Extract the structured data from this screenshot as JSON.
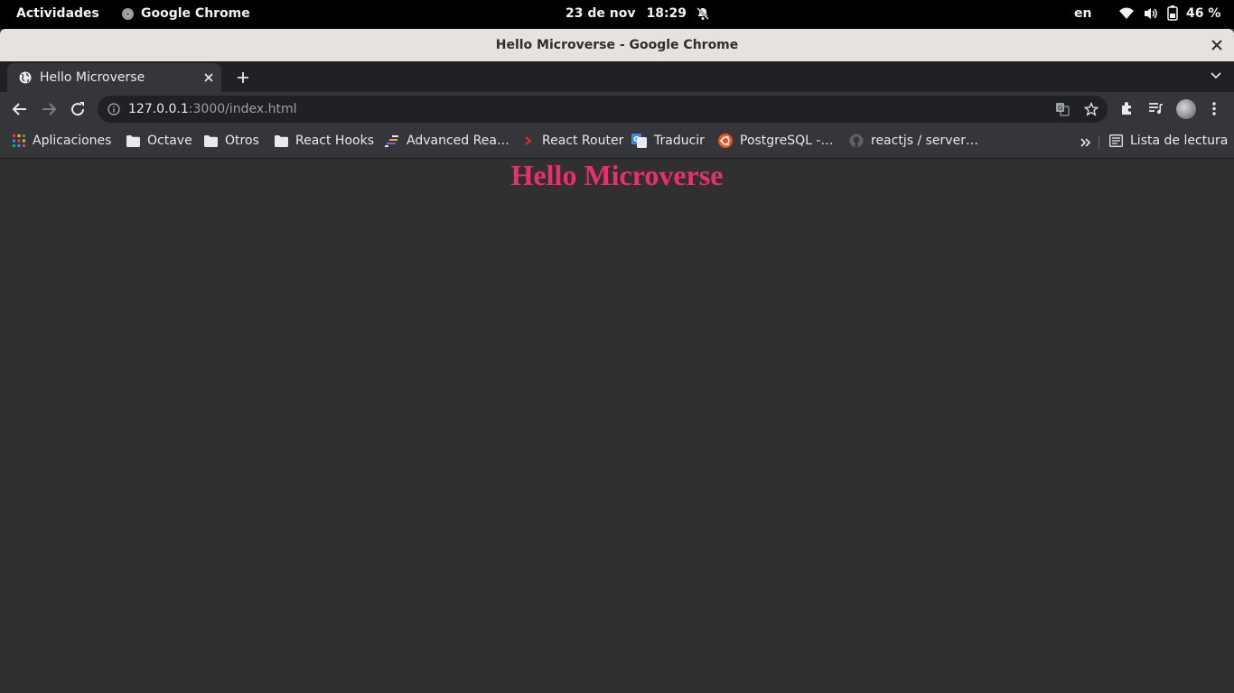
{
  "topbar": {
    "activities": "Actividades",
    "app_name": "Google Chrome",
    "date": "23 de nov",
    "time": "18:29",
    "lang": "en",
    "battery": "46 %"
  },
  "window": {
    "title": "Hello Microverse - Google Chrome"
  },
  "tabs": [
    {
      "label": "Hello Microverse",
      "active": true
    }
  ],
  "omnibox": {
    "host": "127.0.0.1",
    "path": ":3000/index.html"
  },
  "bookmarks": {
    "items": [
      {
        "label": "Aplicaciones",
        "icon": "apps-grid-icon"
      },
      {
        "label": "Octave",
        "icon": "folder-icon"
      },
      {
        "label": "Otros",
        "icon": "folder-icon"
      },
      {
        "label": "React Hooks",
        "icon": "folder-icon"
      },
      {
        "label": "Advanced Rea…",
        "icon": "site-favicon"
      },
      {
        "label": "React Router",
        "icon": "chevron-favicon"
      },
      {
        "label": "Traducir",
        "icon": "google-translate-favicon"
      },
      {
        "label": "PostgreSQL -…",
        "icon": "ubuntu-favicon"
      },
      {
        "label": "reactjs / server…",
        "icon": "github-favicon"
      }
    ],
    "reading_list": "Lista de lectura"
  },
  "page": {
    "heading": "Hello Microverse"
  },
  "colors": {
    "heading": "#e8306a",
    "page_background": "#303030",
    "toolbar": "#35363a",
    "tabstrip": "#202124"
  }
}
